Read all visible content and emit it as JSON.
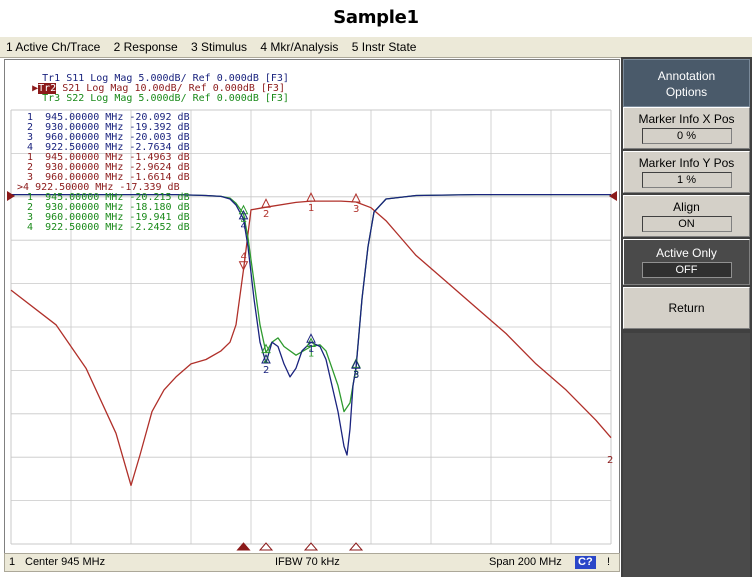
{
  "title": "Sample1",
  "menu": [
    "1 Active Ch/Trace",
    "2 Response",
    "3 Stimulus",
    "4 Mkr/Analysis",
    "5 Instr State"
  ],
  "traces": [
    {
      "id": "Tr1",
      "text": "S11 Log Mag 5.000dB/ Ref 0.000dB [F3]",
      "color": "#1a237e",
      "active": false
    },
    {
      "id": "Tr2",
      "text": "S21 Log Mag 10.00dB/ Ref 0.000dB [F3]",
      "color": "#8b1a1a",
      "active": true
    },
    {
      "id": "Tr3",
      "text": "S22 Log Mag 5.000dB/ Ref 0.000dB [F3]",
      "color": "#1a8a1a",
      "active": false
    }
  ],
  "markers": [
    {
      "n": "1",
      "freq": "945.00000 MHz",
      "val": "-20.092 dB",
      "color": "#1a237e"
    },
    {
      "n": "2",
      "freq": "930.00000 MHz",
      "val": "-19.392 dB",
      "color": "#1a237e"
    },
    {
      "n": "3",
      "freq": "960.00000 MHz",
      "val": "-20.003 dB",
      "color": "#1a237e"
    },
    {
      "n": "4",
      "freq": "922.50000 MHz",
      "val": "-2.7634 dB",
      "color": "#1a237e"
    },
    {
      "n": "1",
      "freq": "945.00000 MHz",
      "val": "-1.4963 dB",
      "color": "#8b1a1a"
    },
    {
      "n": "2",
      "freq": "930.00000 MHz",
      "val": "-2.9624 dB",
      "color": "#8b1a1a"
    },
    {
      "n": "3",
      "freq": "960.00000 MHz",
      "val": "-1.6614 dB",
      "color": "#8b1a1a"
    },
    {
      "n": ">4",
      "freq": "922.50000 MHz",
      "val": "-17.339 dB",
      "color": "#8b1a1a"
    },
    {
      "n": "1",
      "freq": "945.00000 MHz",
      "val": "-20.215 dB",
      "color": "#1a8a1a"
    },
    {
      "n": "2",
      "freq": "930.00000 MHz",
      "val": "-18.180 dB",
      "color": "#1a8a1a"
    },
    {
      "n": "3",
      "freq": "960.00000 MHz",
      "val": "-19.941 dB",
      "color": "#1a8a1a"
    },
    {
      "n": "4",
      "freq": "922.50000 MHz",
      "val": "-2.2452 dB",
      "color": "#1a8a1a"
    }
  ],
  "softkeys": {
    "header": "Annotation Options",
    "marker_x_label": "Marker Info X Pos",
    "marker_x_value": "0 %",
    "marker_y_label": "Marker Info Y Pos",
    "marker_y_value": "1 %",
    "align_label": "Align",
    "align_value": "ON",
    "active_only_label": "Active Only",
    "active_only_value": "OFF",
    "return_label": "Return"
  },
  "status": {
    "channel": "1",
    "center": "Center 945 MHz",
    "ifbw": "IFBW 70 kHz",
    "span": "Span 200 MHz",
    "cal": "C?",
    "warn": "!"
  },
  "trace_end_label": "2",
  "marker_flag_labels": [
    "1",
    "2",
    "3",
    "4"
  ],
  "colors": {
    "s11": "#1a237e",
    "s21": "#b0302a",
    "s22": "#2e9a2e",
    "grid": "#c8c8c8"
  },
  "chart_data": {
    "type": "line",
    "x_range_mhz": [
      845,
      1045
    ],
    "divisions_x": 10,
    "divisions_y": 10,
    "series": [
      {
        "name": "S21",
        "scale_db_per_div": 10,
        "ref_db": 0,
        "x": [
          845,
          860,
          870,
          880,
          885,
          888,
          892,
          896,
          900,
          905,
          910,
          915,
          918,
          920,
          922.5,
          925,
          930,
          940,
          945,
          955,
          960,
          965,
          970,
          975,
          980,
          990,
          1000,
          1010,
          1020,
          1030,
          1040,
          1045
        ],
        "y": [
          -22,
          -30,
          -40,
          -55,
          -67,
          -60,
          -50,
          -45,
          -42,
          -39,
          -38,
          -36,
          -34,
          -30,
          -17.3,
          -3.5,
          -2.9,
          -1.8,
          -1.5,
          -1.5,
          -1.7,
          -3,
          -6,
          -10,
          -14,
          -20,
          -26,
          -32,
          -39,
          -45,
          -52,
          -56
        ]
      },
      {
        "name": "S11",
        "scale_db_per_div": 5,
        "ref_db": 0,
        "x": [
          845,
          900,
          910,
          915,
          918,
          920,
          922.5,
          924,
          926,
          928,
          930,
          932,
          934,
          936,
          938,
          940,
          942,
          945,
          948,
          950,
          952,
          954,
          956,
          957,
          958,
          959,
          960,
          962,
          964,
          966,
          970,
          980,
          1000,
          1045
        ],
        "y": [
          0,
          0,
          -0.1,
          -0.2,
          -0.5,
          -1.2,
          -2.8,
          -6,
          -12,
          -17,
          -19.4,
          -17,
          -17.5,
          -19.5,
          -21,
          -20,
          -18,
          -17,
          -17.5,
          -19,
          -22,
          -25,
          -29,
          -30,
          -27,
          -22,
          -20,
          -12,
          -6,
          -2,
          -0.5,
          -0.1,
          0,
          0
        ]
      },
      {
        "name": "S22",
        "scale_db_per_div": 5,
        "ref_db": 0,
        "x": [
          845,
          900,
          910,
          915,
          918,
          920,
          922.5,
          924,
          926,
          928,
          930,
          932,
          934,
          936,
          940,
          945,
          948,
          950,
          952,
          954,
          956,
          958,
          960,
          962,
          964,
          966,
          970,
          980,
          1000,
          1045
        ],
        "y": [
          0,
          0,
          -0.1,
          -0.2,
          -0.4,
          -1,
          -2.2,
          -5,
          -10,
          -15,
          -18.2,
          -17,
          -16.5,
          -17.5,
          -18.5,
          -17.5,
          -17.3,
          -18,
          -20,
          -22,
          -25,
          -24,
          -19.9,
          -12,
          -6,
          -2,
          -0.5,
          -0.1,
          0,
          0
        ]
      }
    ]
  }
}
